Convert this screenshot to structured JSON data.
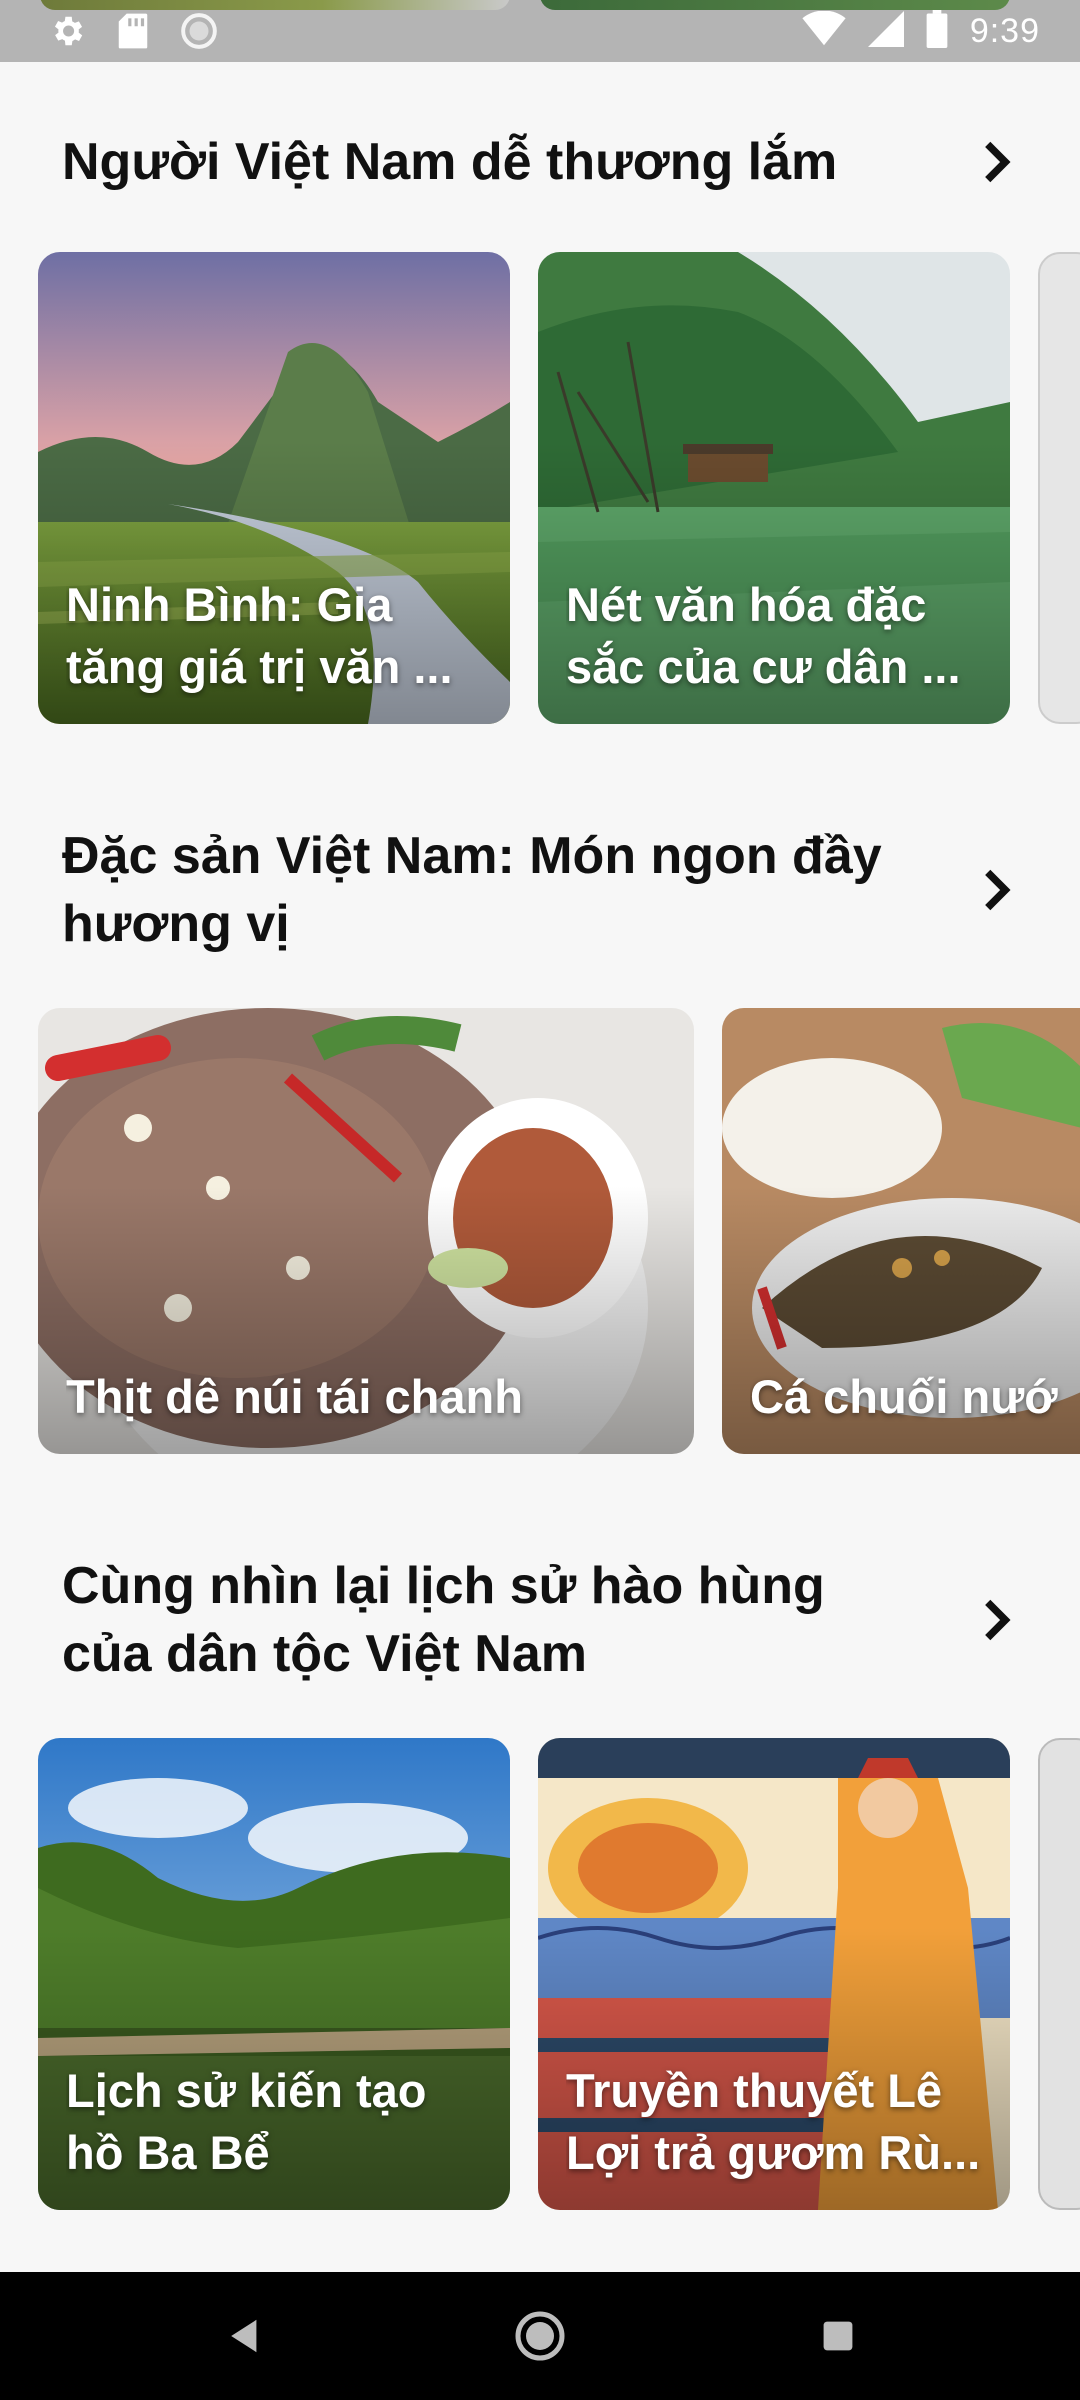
{
  "status_bar": {
    "time": "9:39",
    "left_icons": [
      "gear-icon",
      "sd-card-icon",
      "circle-icon"
    ],
    "right_icons": [
      "wifi-icon",
      "signal-icon",
      "battery-icon"
    ]
  },
  "sections": [
    {
      "title": "Người Việt Nam dễ thương lắm",
      "cards": [
        {
          "title": "Ninh Bình: Gia tăng giá trị văn ..."
        },
        {
          "title": "Nét văn hóa đặc sắc của cư dân ..."
        }
      ]
    },
    {
      "title": "Đặc sản Việt Nam: Món ngon đầy hương vị",
      "cards": [
        {
          "title": "Thịt dê núi tái chanh"
        },
        {
          "title": "Cá chuối nướ"
        }
      ]
    },
    {
      "title": "Cùng nhìn lại lịch sử hào hùng của dân tộc Việt Nam",
      "cards": [
        {
          "title": "Lịch sử kiến tạo hồ Ba Bể"
        },
        {
          "title": "Truyền thuyết Lê Lợi trả gươm Rù..."
        }
      ]
    }
  ],
  "nav_bar": {
    "buttons": [
      "back-icon",
      "home-icon",
      "recents-icon"
    ]
  },
  "colors": {
    "background": "#f7f7f7",
    "status_bar": "#b4b4b4",
    "nav_bar": "#000000",
    "title_text": "#111111"
  }
}
